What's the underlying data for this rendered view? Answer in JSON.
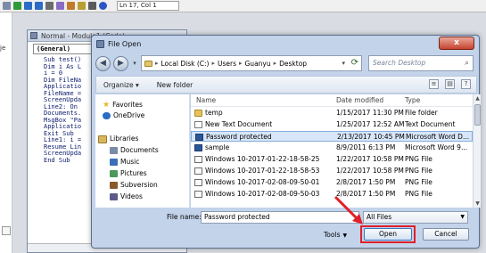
{
  "ide": {
    "cursor_position": "Ln 17, Col 1",
    "left_strip_text": "je",
    "module_window_title": "Normal - Module1 (Code)",
    "procedure_combo": "(General)",
    "code_lines": [
      "Sub test()",
      "Dim i As L",
      "i = 0",
      "Dim FileNa",
      "Applicatio",
      "FileName =",
      "ScreenUpda",
      "Line2: On",
      "Documents.",
      "MsgBox \"Pa",
      "Applicatio",
      "Exit Sub",
      "Line1: i =",
      "Resume Lin",
      "ScreenUpda",
      "End Sub"
    ]
  },
  "dialog": {
    "title": "File Open",
    "close_label": "x",
    "nav": {
      "back_label": "◀",
      "forward_label": "▶",
      "dropdown_label": "▾",
      "breadcrumb": [
        "Local Disk (C:)",
        "Users",
        "Guanyu",
        "Desktop"
      ],
      "breadcrumb_separator": "▸",
      "search_placeholder": "Search Desktop"
    },
    "commands": {
      "organize": "Organize ▾",
      "new_folder": "New folder",
      "view_buttons": [
        "≡",
        "▤",
        "?"
      ]
    },
    "nav_pane": {
      "items": [
        {
          "label": "Favorites",
          "icon": "star-icon",
          "color": "#e5b72b"
        },
        {
          "label": "OneDrive",
          "icon": "cloud-icon",
          "color": "#2b6cc4"
        },
        {
          "label": "Libraries",
          "icon": "library-icon",
          "color": "#d9b55c"
        },
        {
          "label": "Documents",
          "icon": "documents-icon",
          "color": "#7b8aa6"
        },
        {
          "label": "Music",
          "icon": "music-icon",
          "color": "#3a6fb8"
        },
        {
          "label": "Pictures",
          "icon": "pictures-icon",
          "color": "#4b9a5b"
        },
        {
          "label": "Subversion",
          "icon": "subversion-icon",
          "color": "#8b5a2b"
        },
        {
          "label": "Videos",
          "icon": "videos-icon",
          "color": "#5a5a8b"
        }
      ]
    },
    "columns": {
      "name": "Name",
      "date_modified": "Date modified",
      "type": "Type",
      "sort_indicator": "˄"
    },
    "files": [
      {
        "name": "temp",
        "date": "1/15/2017 11:30 PM",
        "type": "File folder",
        "icon": "folder-icon"
      },
      {
        "name": "New Text Document",
        "date": "1/25/2017 12:52 AM",
        "type": "Text Document",
        "icon": "text-document-icon"
      },
      {
        "name": "Password protected",
        "date": "2/13/2017 10:45 PM",
        "type": "Microsoft Word D...",
        "icon": "word-document-icon",
        "selected": true
      },
      {
        "name": "sample",
        "date": "8/9/2011 6:13 PM",
        "type": "Microsoft Word 9...",
        "icon": "word-document-icon"
      },
      {
        "name": "Windows 10-2017-01-22-18-58-25",
        "date": "1/22/2017 10:58 PM",
        "type": "PNG File",
        "icon": "png-file-icon"
      },
      {
        "name": "Windows 10-2017-01-22-18-58-53",
        "date": "1/22/2017 10:58 PM",
        "type": "PNG File",
        "icon": "png-file-icon"
      },
      {
        "name": "Windows 10-2017-02-08-09-50-01",
        "date": "2/8/2017 1:50 PM",
        "type": "PNG File",
        "icon": "png-file-icon"
      },
      {
        "name": "Windows 10-2017-02-08-09-50-03",
        "date": "2/8/2017 1:50 PM",
        "type": "PNG File",
        "icon": "png-file-icon"
      }
    ],
    "bottom": {
      "file_name_label": "File name:",
      "file_name_value": "Password protected",
      "file_type_value": "All Files",
      "tools_label": "Tools",
      "open_label": "Open",
      "cancel_label": "Cancel"
    },
    "highlight_color": "#e0202a"
  }
}
